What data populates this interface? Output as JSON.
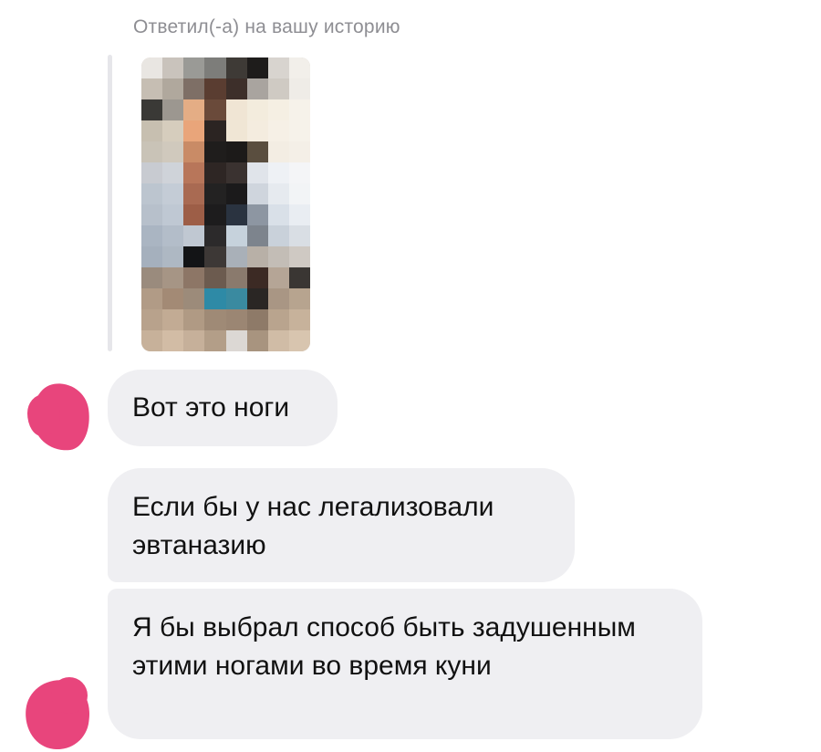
{
  "reply_header": "Ответил(-а) на вашу историю",
  "story": {
    "pixels": [
      "#e9e6e2",
      "#c9c3bc",
      "#9a9a96",
      "#7d7d7a",
      "#3e3a36",
      "#1e1c1b",
      "#d8d4cf",
      "#f2efea",
      "#c6beb3",
      "#b0a89d",
      "#7e6f66",
      "#5a3d31",
      "#3d2f2a",
      "#a9a49f",
      "#cfcac3",
      "#efece7",
      "#3a3936",
      "#9c9790",
      "#e4ad85",
      "#6a4a3a",
      "#f0e5d4",
      "#f3ecdd",
      "#f5efe3",
      "#f6f2ea",
      "#c7bfb0",
      "#d6cdbd",
      "#e9a57a",
      "#2b2422",
      "#f0e6d5",
      "#f4ecdf",
      "#f6f0e6",
      "#f6f2ea",
      "#c9c3b7",
      "#d0c9bd",
      "#c98b66",
      "#1f1d1c",
      "#1c1a19",
      "#5a4e3f",
      "#f3ede3",
      "#f4efe7",
      "#c8cbd1",
      "#cfd3d9",
      "#b8765a",
      "#2e2624",
      "#3a3230",
      "#e0e4ea",
      "#eef1f5",
      "#f4f5f7",
      "#bcc5cf",
      "#c4ccd6",
      "#a96a52",
      "#232222",
      "#1b1a1b",
      "#cfd5dd",
      "#e6eaef",
      "#f2f4f6",
      "#b7c0cb",
      "#bfc8d3",
      "#9d5e47",
      "#1d1c1d",
      "#2a3340",
      "#8d96a2",
      "#d9e0e8",
      "#e9edf2",
      "#aab5c2",
      "#b3bdc9",
      "#c0c8d2",
      "#2c2a2b",
      "#c6d2dc",
      "#7d848d",
      "#c9d1da",
      "#d9dee4",
      "#a5b0bd",
      "#aeb8c3",
      "#131416",
      "#3d3836",
      "#a9b0b8",
      "#b8b0a7",
      "#c3bdb6",
      "#cfc9c3",
      "#9a8b7d",
      "#a69585",
      "#8d7666",
      "#6c5b4f",
      "#8a7a6d",
      "#3c2a24",
      "#b5a596",
      "#3a3633",
      "#b19b86",
      "#a38a75",
      "#9c8b7a",
      "#2e8aa6",
      "#3a8aa0",
      "#2a2624",
      "#a99684",
      "#b7a48f",
      "#b8a28c",
      "#c2ab94",
      "#b09a84",
      "#9f8a76",
      "#9b8673",
      "#8e7a68",
      "#b9a48e",
      "#c7b29b",
      "#c7b19a",
      "#d2bca5",
      "#c6b09a",
      "#b39e88",
      "#dcd8d4",
      "#a8947f",
      "#d0bca6",
      "#d8c5af"
    ]
  },
  "messages": [
    {
      "text": "Вот это ноги"
    },
    {
      "text": "Если бы у нас легализовали эвтаназию"
    },
    {
      "text": "Я бы выбрал способ быть задушенным этими ногами во время куни"
    }
  ],
  "colors": {
    "bubble_bg": "#efeff2",
    "header_text": "#8e8e93",
    "avatar_redaction": "#e8457c"
  }
}
